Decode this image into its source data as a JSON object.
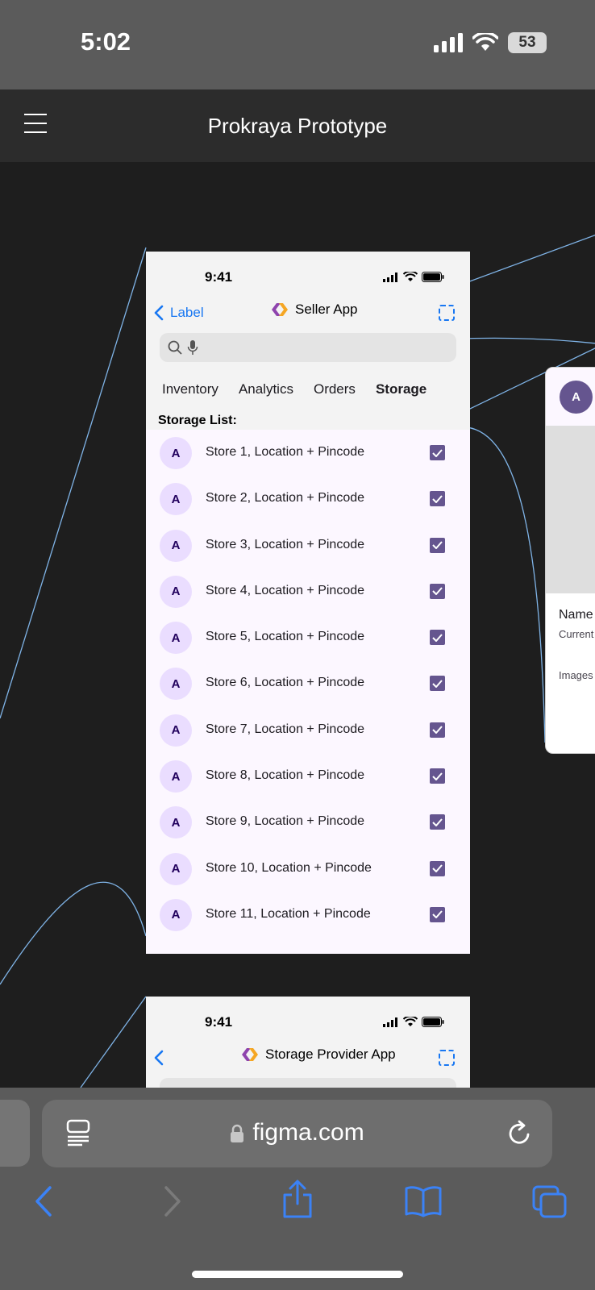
{
  "status_bar": {
    "time": "5:02",
    "battery": "53"
  },
  "figma": {
    "title": "Prokraya Prototype"
  },
  "seller_frame": {
    "time": "9:41",
    "back_label": "Label",
    "title": "Seller App",
    "tabs": [
      "Inventory",
      "Analytics",
      "Orders",
      "Storage"
    ],
    "active_tab": "Storage",
    "list_label": "Storage List:",
    "stores": [
      {
        "avatar": "A",
        "name": "Store 1, Location + Pincode",
        "checked": true
      },
      {
        "avatar": "A",
        "name": "Store 2, Location + Pincode",
        "checked": true
      },
      {
        "avatar": "A",
        "name": "Store 3, Location + Pincode",
        "checked": true
      },
      {
        "avatar": "A",
        "name": "Store 4, Location + Pincode",
        "checked": true
      },
      {
        "avatar": "A",
        "name": "Store 5, Location + Pincode",
        "checked": true
      },
      {
        "avatar": "A",
        "name": "Store 6, Location + Pincode",
        "checked": true
      },
      {
        "avatar": "A",
        "name": "Store 7, Location + Pincode",
        "checked": true
      },
      {
        "avatar": "A",
        "name": "Store 8, Location + Pincode",
        "checked": true
      },
      {
        "avatar": "A",
        "name": "Store 9, Location + Pincode",
        "checked": true
      },
      {
        "avatar": "A",
        "name": "Store 10, Location + Pincode",
        "checked": true
      },
      {
        "avatar": "A",
        "name": "Store 11, Location + Pincode",
        "checked": true
      }
    ]
  },
  "provider_frame": {
    "time": "9:41",
    "title": "Storage Provider App"
  },
  "side_card": {
    "avatar": "A",
    "name": "Name",
    "current": "Current",
    "images": "Images"
  },
  "safari": {
    "url": "figma.com"
  },
  "colors": {
    "accent": "#1877f2",
    "checkbox": "#65558f",
    "avatar_bg": "#eaddff",
    "wire": "#7fb3e6"
  }
}
